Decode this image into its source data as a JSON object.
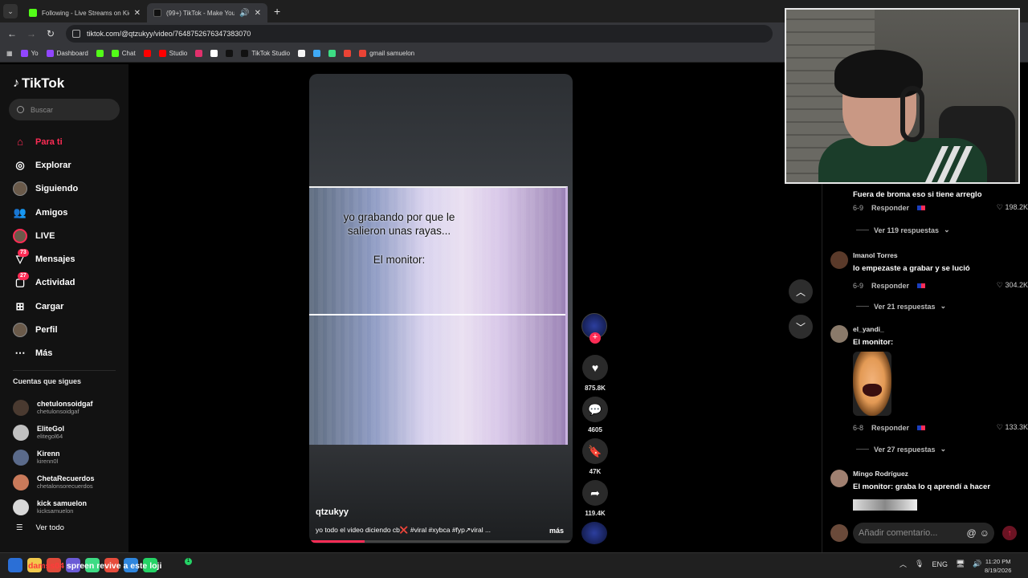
{
  "browser": {
    "tabs": [
      {
        "title": "Following - Live Streams on Kick",
        "favicon_color": "#53fc18"
      },
      {
        "title": "(99+) TikTok - Make Your Day",
        "favicon_color": "#111111",
        "active": true
      }
    ],
    "url": "tiktok.com/@qtzukyy/video/7648752676347383070",
    "bookmarks": [
      {
        "label": "Yo",
        "color": "#9146ff"
      },
      {
        "label": "Dashboard",
        "color": "#9146ff"
      },
      {
        "label": "",
        "color": "#53fc18"
      },
      {
        "label": "Chat",
        "color": "#53fc18"
      },
      {
        "label": "",
        "color": "#ff0000"
      },
      {
        "label": "Studio",
        "color": "#ff0000"
      },
      {
        "label": "",
        "color": "#e1306c"
      },
      {
        "label": "",
        "color": "#ffffff"
      },
      {
        "label": "",
        "color": "#111111"
      },
      {
        "label": "TikTok Studio",
        "color": "#111111"
      },
      {
        "label": "",
        "color": "#f5f5f5"
      },
      {
        "label": "",
        "color": "#3fa9f5"
      },
      {
        "label": "",
        "color": "#3ddc84"
      },
      {
        "label": "",
        "color": "#ea4335"
      },
      {
        "label": "gmail samuelon",
        "color": "#ea4335"
      }
    ]
  },
  "sidebar": {
    "logo": "TikTok",
    "search_placeholder": "Buscar",
    "nav": [
      {
        "label": "Para ti",
        "icon": "home-icon",
        "active": true
      },
      {
        "label": "Explorar",
        "icon": "compass-icon"
      },
      {
        "label": "Siguiendo",
        "icon": "following-avatar"
      },
      {
        "label": "Amigos",
        "icon": "friends-icon"
      },
      {
        "label": "LIVE",
        "icon": "live-avatar"
      },
      {
        "label": "Mensajes",
        "icon": "message-icon",
        "badge": "73"
      },
      {
        "label": "Actividad",
        "icon": "activity-icon",
        "badge": "27"
      },
      {
        "label": "Cargar",
        "icon": "upload-icon"
      },
      {
        "label": "Perfil",
        "icon": "profile-avatar"
      },
      {
        "label": "Más",
        "icon": "more-icon"
      }
    ],
    "following_title": "Cuentas que sigues",
    "following": [
      {
        "name": "chetulonsoidgaf",
        "handle": "chetulonsoidgaf",
        "color": "#4a3a30"
      },
      {
        "name": "EliteGol",
        "handle": "elitegol64",
        "color": "#c0c0c0",
        "verified": true
      },
      {
        "name": "Kirenn",
        "handle": "kirenn0l",
        "color": "#5a6a8a"
      },
      {
        "name": "ChetaRecuerdos",
        "handle": "chetalonsorecuerdos",
        "color": "#c97a5a"
      },
      {
        "name": "kick samuelon",
        "handle": "kicksamuelon",
        "color": "#d8d8d8"
      }
    ],
    "see_all": "Ver todo"
  },
  "video": {
    "caption_line1": "yo grabando por que le",
    "caption_line2": "salieron unas rayas...",
    "caption_line3": "El monitor:",
    "username": "qtzukyy",
    "description": "yo todo el video diciendo cb❌ #viral #xybca #fyp↗viral ...",
    "more": "más",
    "progress": 0.21
  },
  "actions": {
    "likes": "875.8K",
    "comments": "4605",
    "saves": "47K",
    "shares": "119.4K"
  },
  "comments": [
    {
      "user": "",
      "text": "Fuera de broma eso si tiene arreglo",
      "date": "6-9",
      "reply": "Responder",
      "likes": "198.2K",
      "more_replies": "Ver 119 respuestas"
    },
    {
      "user": "Imanol Torres",
      "text": "lo empezaste a grabar y se lució",
      "date": "6-9",
      "reply": "Responder",
      "likes": "304.2K",
      "more_replies": "Ver 21 respuestas",
      "avatar_color": "#5a3a2a"
    },
    {
      "user": "el_yandi_",
      "text": "El monitor:",
      "date": "6-8",
      "reply": "Responder",
      "likes": "133.3K",
      "more_replies": "Ver 27 respuestas",
      "avatar_color": "#8a7a6a"
    },
    {
      "user": "Mingo Rodríguez",
      "text": "El monitor: graba lo q aprendí a hacer",
      "avatar_color": "#a08070"
    }
  ],
  "comment_input_placeholder": "Añadir comentario...",
  "taskbar": {
    "chat_user": "damss04",
    "chat_message": "spreen revive a este loji",
    "whatsapp_badge": "1",
    "lang": "ENG",
    "time": "11:20 PM",
    "date": "8/19/2026"
  }
}
